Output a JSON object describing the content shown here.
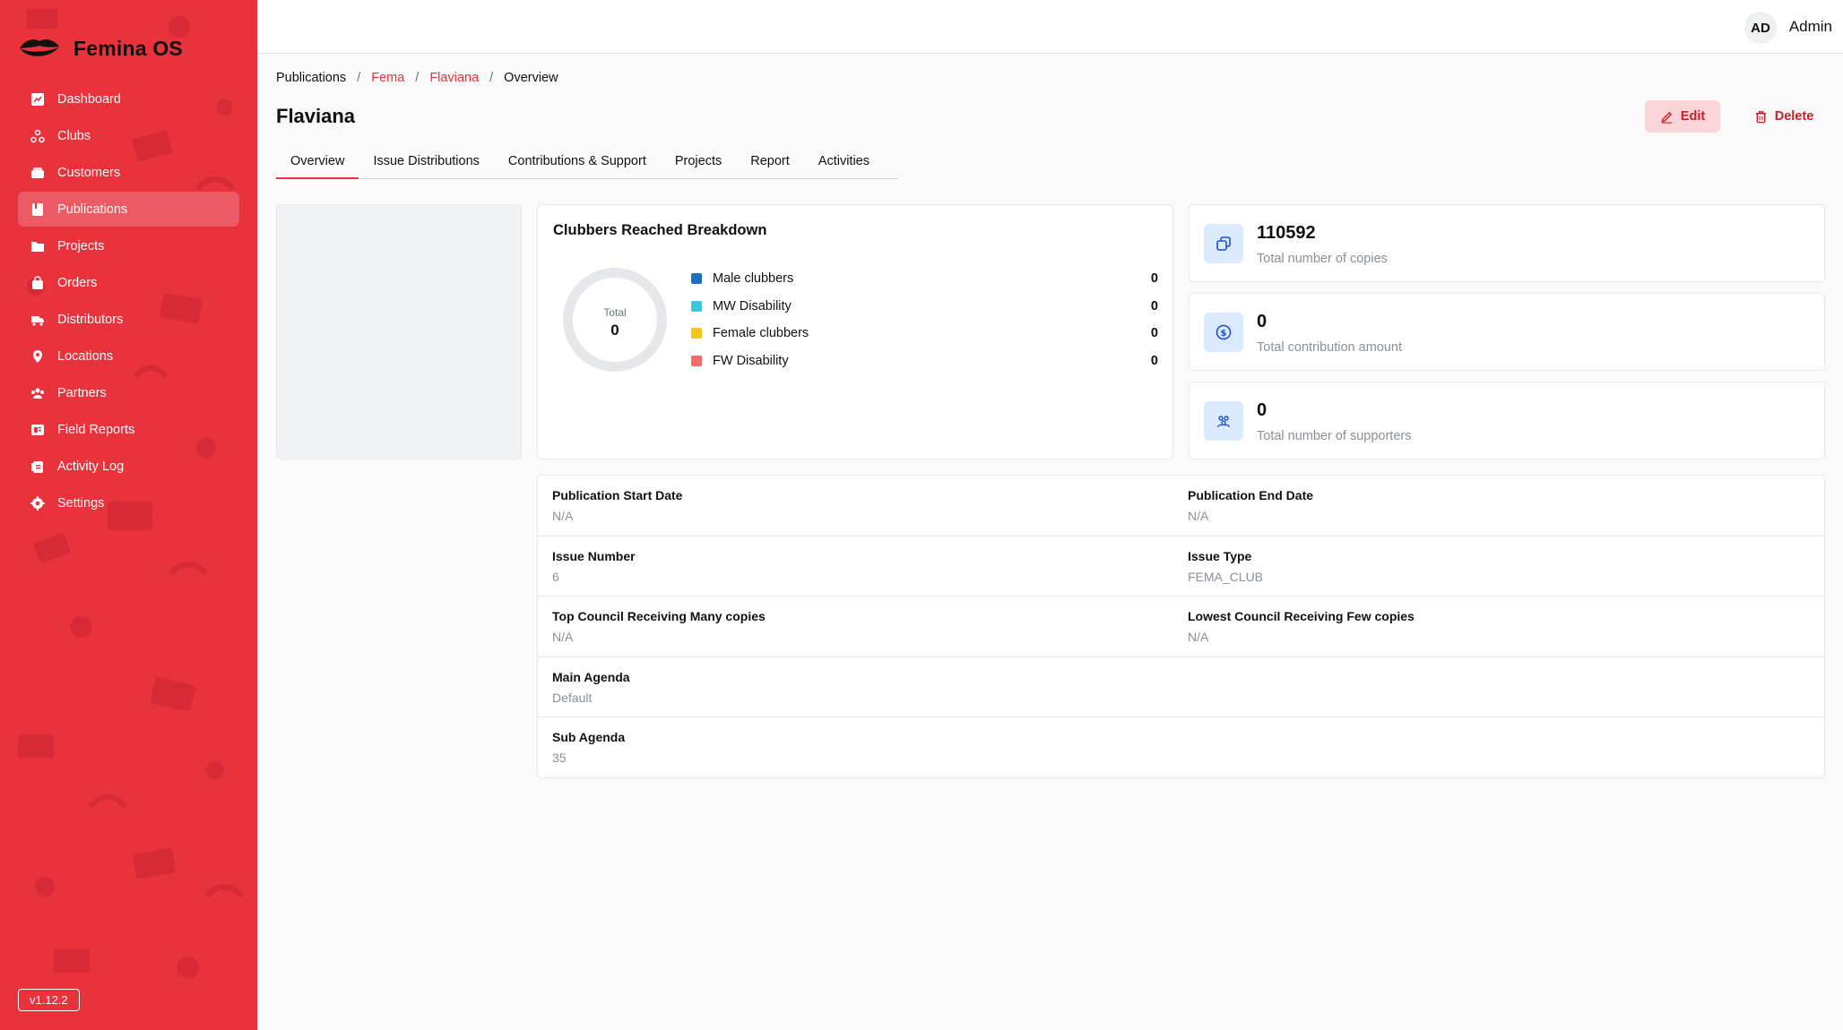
{
  "brand": {
    "name": "Femina OS"
  },
  "sidebar": {
    "items": [
      {
        "label": "Dashboard",
        "icon": "chart-icon",
        "active": false
      },
      {
        "label": "Clubs",
        "icon": "network-icon",
        "active": false
      },
      {
        "label": "Customers",
        "icon": "folder-icon",
        "active": false
      },
      {
        "label": "Publications",
        "icon": "book-icon",
        "active": true
      },
      {
        "label": "Projects",
        "icon": "folder-open-icon",
        "active": false
      },
      {
        "label": "Orders",
        "icon": "shopping-bag-icon",
        "active": false
      },
      {
        "label": "Distributors",
        "icon": "truck-icon",
        "active": false
      },
      {
        "label": "Locations",
        "icon": "map-pin-icon",
        "active": false
      },
      {
        "label": "Partners",
        "icon": "users-icon",
        "active": false
      },
      {
        "label": "Field Reports",
        "icon": "report-icon",
        "active": false
      },
      {
        "label": "Activity Log",
        "icon": "clipboard-icon",
        "active": false
      },
      {
        "label": "Settings",
        "icon": "gear-icon",
        "active": false
      }
    ],
    "version": "v1.12.2"
  },
  "topbar": {
    "initials": "AD",
    "user": "Admin"
  },
  "breadcrumb": {
    "items": [
      "Publications",
      "Fema",
      "Flaviana",
      "Overview"
    ],
    "separator": "/"
  },
  "page": {
    "title": "Flaviana",
    "edit_label": "Edit",
    "delete_label": "Delete"
  },
  "tabs": [
    {
      "label": "Overview",
      "active": true
    },
    {
      "label": "Issue Distributions",
      "active": false
    },
    {
      "label": "Contributions & Support",
      "active": false
    },
    {
      "label": "Projects",
      "active": false
    },
    {
      "label": "Report",
      "active": false
    },
    {
      "label": "Activities",
      "active": false
    }
  ],
  "breakdown": {
    "title": "Clubbers Reached Breakdown",
    "total_label": "Total",
    "total_value": "0",
    "legend": [
      {
        "label": "Male clubbers",
        "value": "0",
        "color": "#1d6fc5"
      },
      {
        "label": "MW Disability",
        "value": "0",
        "color": "#3cc8dc"
      },
      {
        "label": "Female clubbers",
        "value": "0",
        "color": "#f5c518"
      },
      {
        "label": "FW Disability",
        "value": "0",
        "color": "#f36b6b"
      }
    ]
  },
  "stats": [
    {
      "value": "110592",
      "label": "Total number of copies",
      "icon": "copy-icon"
    },
    {
      "value": "0",
      "label": "Total contribution amount",
      "icon": "dollar-icon"
    },
    {
      "value": "0",
      "label": "Total number of supporters",
      "icon": "supporters-icon"
    }
  ],
  "details": {
    "start_date": {
      "label": "Publication Start Date",
      "value": "N/A"
    },
    "end_date": {
      "label": "Publication End Date",
      "value": "N/A"
    },
    "issue_number": {
      "label": "Issue Number",
      "value": "6"
    },
    "issue_type": {
      "label": "Issue Type",
      "value": "FEMA_CLUB"
    },
    "top_council": {
      "label": "Top Council Receiving Many copies",
      "value": "N/A"
    },
    "lowest_council": {
      "label": "Lowest Council Receiving Few copies",
      "value": "N/A"
    },
    "main_agenda": {
      "label": "Main Agenda",
      "value": "Default"
    },
    "sub_agenda": {
      "label": "Sub Agenda",
      "value": "35"
    }
  },
  "colors": {
    "brand": "#e8323c",
    "accent_soft": "#fbd5d8",
    "icon_bg": "#dbeafe"
  }
}
